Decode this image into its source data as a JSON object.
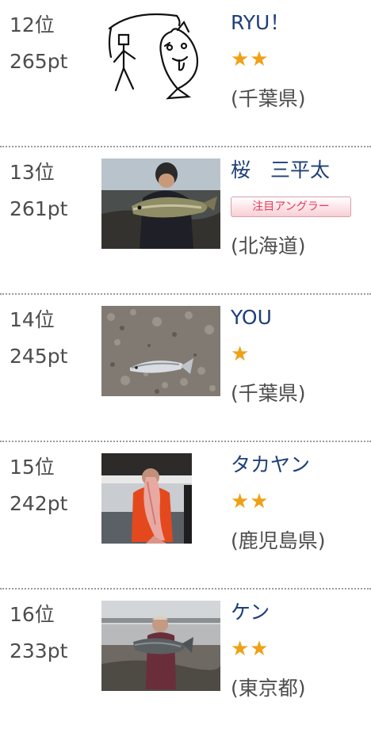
{
  "rankings": [
    {
      "rank": "12位",
      "points": "265pt",
      "name": "RYU！",
      "stars": "★★",
      "prefecture": "(千葉県)",
      "photo": "hand-drawn-fish-sketch"
    },
    {
      "rank": "13位",
      "points": "261pt",
      "name": "桜　三平太",
      "badge": "注目アングラー",
      "prefecture": "(北海道)",
      "photo": "angler-holding-fish"
    },
    {
      "rank": "14位",
      "points": "245pt",
      "name": "YOU",
      "stars": "★",
      "prefecture": "(千葉県)",
      "photo": "fish-on-gravel"
    },
    {
      "rank": "15位",
      "points": "242pt",
      "name": "タカヤン",
      "stars": "★★",
      "prefecture": "(鹿児島県)",
      "photo": "angler-red-jacket-fish"
    },
    {
      "rank": "16位",
      "points": "233pt",
      "name": "ケン",
      "stars": "★★",
      "prefecture": "(東京都)",
      "photo": "angler-beach-fish"
    }
  ],
  "colors": {
    "link": "#1e3f7a",
    "star": "#f0a015",
    "badge_text": "#e33a55",
    "divider": "#9a9a9a"
  }
}
